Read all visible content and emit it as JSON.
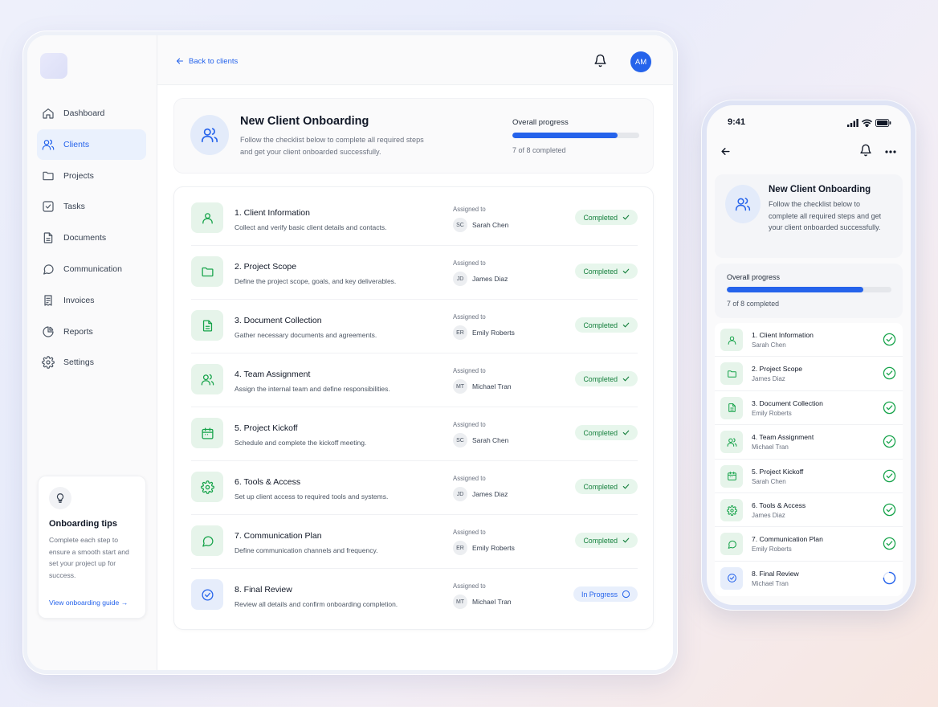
{
  "sidebar": {
    "nav": [
      {
        "label": "Dashboard",
        "icon": "home-icon"
      },
      {
        "label": "Clients",
        "icon": "users-icon",
        "active": true
      },
      {
        "label": "Projects",
        "icon": "folder-icon"
      },
      {
        "label": "Tasks",
        "icon": "checkbox-icon"
      },
      {
        "label": "Documents",
        "icon": "document-icon"
      },
      {
        "label": "Communication",
        "icon": "chat-icon"
      },
      {
        "label": "Invoices",
        "icon": "invoice-icon"
      },
      {
        "label": "Reports",
        "icon": "chart-icon"
      },
      {
        "label": "Settings",
        "icon": "gear-icon"
      }
    ],
    "tips": {
      "title": "Onboarding tips",
      "text": "Complete each step to ensure a smooth start and set your project up for success.",
      "link": "View onboarding guide →"
    }
  },
  "topbar": {
    "back_label": "Back to clients",
    "avatar_initials": "AM"
  },
  "header": {
    "title": "New Client Onboarding",
    "description": "Follow the checklist below to complete all required steps and get your client onboarded successfully.",
    "progress_label": "Overall progress",
    "progress_text": "7 of 8 completed",
    "progress_fraction": 0.83
  },
  "assigned_label": "Assigned to",
  "steps": [
    {
      "title": "1. Client Information",
      "short": "Client Information",
      "desc": "Collect and verify basic client details and contacts.",
      "initials": "SC",
      "assignee": "Sarah Chen",
      "status": "Completed",
      "icon": "user-icon"
    },
    {
      "title": "2. Project Scope",
      "short": "Project Scope",
      "desc": "Define the project scope, goals, and key deliverables.",
      "initials": "JD",
      "assignee": "James Diaz",
      "status": "Completed",
      "icon": "folder-icon"
    },
    {
      "title": "3. Document Collection",
      "short": "Document Collection",
      "desc": "Gather necessary documents and agreements.",
      "initials": "ER",
      "assignee": "Emily Roberts",
      "status": "Completed",
      "icon": "document-icon"
    },
    {
      "title": "4. Team Assignment",
      "short": "Team Assignment",
      "desc": "Assign the internal team and define responsibilities.",
      "initials": "MT",
      "assignee": "Michael Tran",
      "status": "Completed",
      "icon": "team-icon"
    },
    {
      "title": "5. Project Kickoff",
      "short": "Project Kickoff",
      "desc": "Schedule and complete the kickoff meeting.",
      "initials": "SC",
      "assignee": "Sarah Chen",
      "status": "Completed",
      "icon": "calendar-icon"
    },
    {
      "title": "6. Tools & Access",
      "short": "Tools & Access",
      "desc": "Set up client access to required tools and systems.",
      "initials": "JD",
      "assignee": "James Diaz",
      "status": "Completed",
      "icon": "gear-icon"
    },
    {
      "title": "7. Communication Plan",
      "short": "Communication Plan",
      "desc": "Define communication channels and frequency.",
      "initials": "ER",
      "assignee": "Emily Roberts",
      "status": "Completed",
      "icon": "chat-icon"
    },
    {
      "title": "8. Final Review",
      "short": "Final Review",
      "desc": "Review all details and confirm onboarding completion.",
      "initials": "MT",
      "assignee": "Michael Tran",
      "status": "In Progress",
      "icon": "check-circle-icon"
    }
  ],
  "phone": {
    "time": "9:41",
    "title": "New Client Onboarding",
    "description": "Follow the checklist below to complete all required steps and get your client onboarded successfully.",
    "progress_label": "Overall progress",
    "progress_text": "7 of 8 completed"
  },
  "colors": {
    "accent": "#2563eb",
    "success": "#16a34a",
    "success_bg": "#e7f6ec"
  }
}
